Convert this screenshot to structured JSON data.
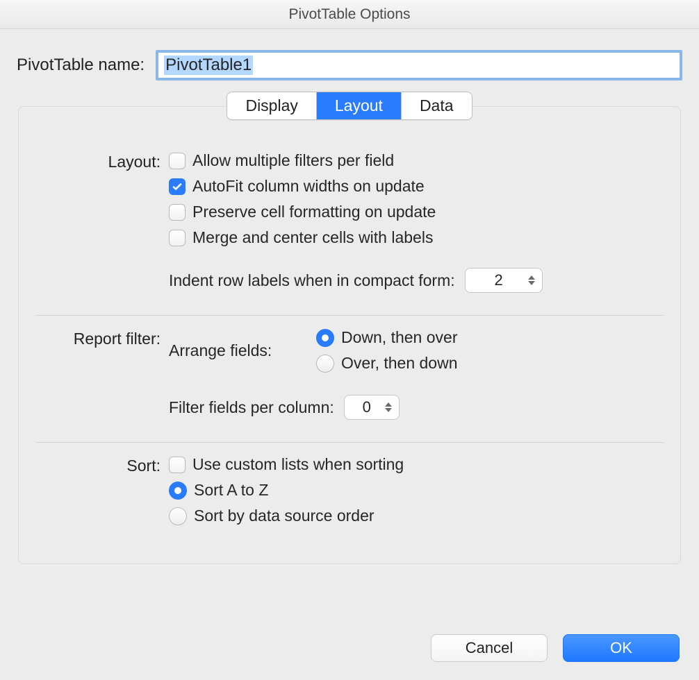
{
  "window": {
    "title": "PivotTable Options"
  },
  "name": {
    "label": "PivotTable name:",
    "value": "PivotTable1"
  },
  "tabs": {
    "display": "Display",
    "layout": "Layout",
    "data": "Data",
    "active": "layout"
  },
  "layout": {
    "section_label": "Layout:",
    "allow_multiple_filters": {
      "label": "Allow multiple filters per field",
      "checked": false
    },
    "autofit_columns": {
      "label": "AutoFit column widths on update",
      "checked": true
    },
    "preserve_formatting": {
      "label": "Preserve cell formatting on update",
      "checked": false
    },
    "merge_center": {
      "label": "Merge and center cells with labels",
      "checked": false
    },
    "indent": {
      "label": "Indent row labels when in compact form:",
      "value": "2"
    }
  },
  "report_filter": {
    "section_label": "Report filter:",
    "arrange_label": "Arrange fields:",
    "options": {
      "down_then_over": "Down, then over",
      "over_then_down": "Over, then down",
      "selected": "down_then_over"
    },
    "per_column": {
      "label": "Filter fields per column:",
      "value": "0"
    }
  },
  "sort": {
    "section_label": "Sort:",
    "use_custom_lists": {
      "label": "Use custom lists when sorting",
      "checked": false
    },
    "options": {
      "a_to_z": "Sort A to Z",
      "data_source": "Sort by data source order",
      "selected": "a_to_z"
    }
  },
  "buttons": {
    "cancel": "Cancel",
    "ok": "OK"
  }
}
